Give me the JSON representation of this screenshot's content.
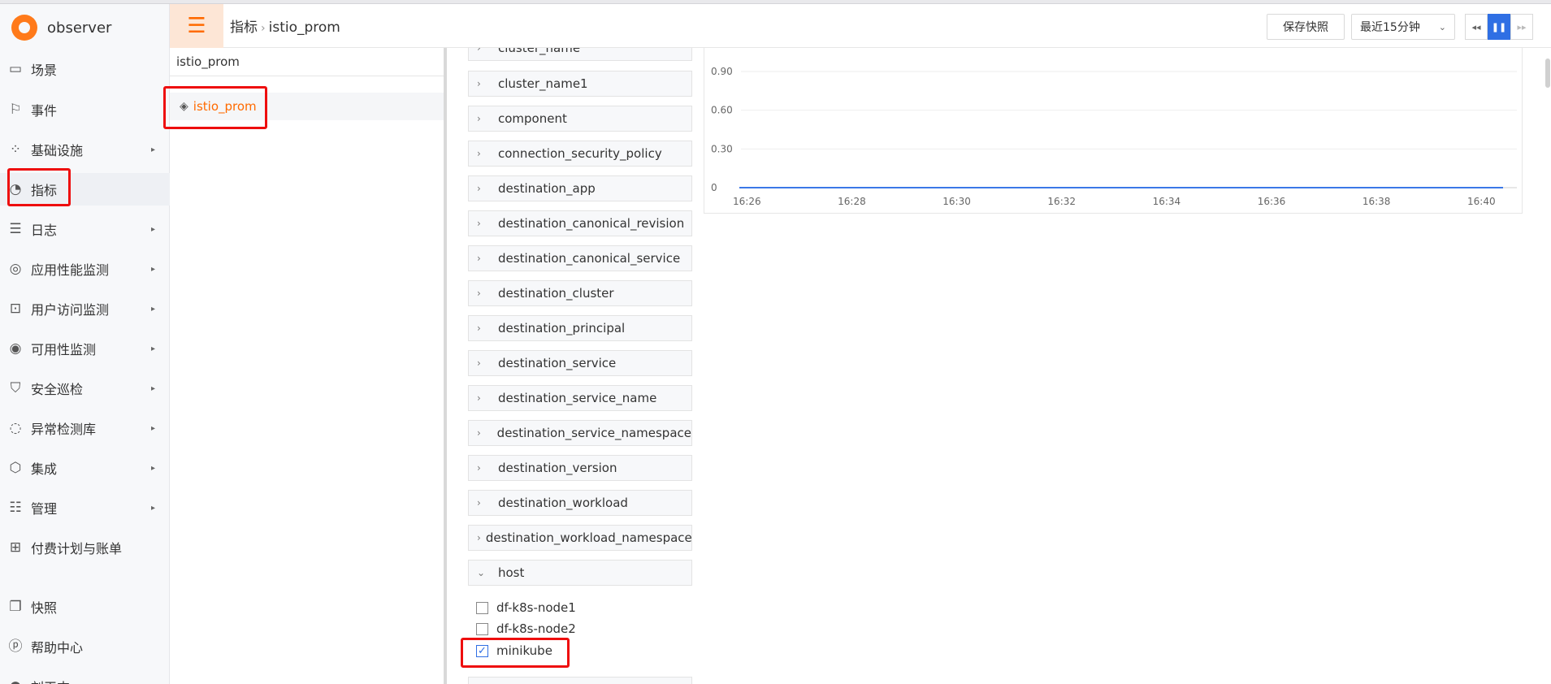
{
  "app": {
    "name": "observer"
  },
  "sidebar": {
    "items": [
      {
        "label": "场景",
        "icon": "dashboard-icon",
        "has_submenu": false
      },
      {
        "label": "事件",
        "icon": "flag-icon",
        "has_submenu": false
      },
      {
        "label": "基础设施",
        "icon": "apps-icon",
        "has_submenu": true
      },
      {
        "label": "指标",
        "icon": "metrics-icon",
        "has_submenu": false,
        "active": true
      },
      {
        "label": "日志",
        "icon": "log-icon",
        "has_submenu": true
      },
      {
        "label": "应用性能监测",
        "icon": "target-icon",
        "has_submenu": true
      },
      {
        "label": "用户访问监测",
        "icon": "monitor-icon",
        "has_submenu": true
      },
      {
        "label": "可用性监测",
        "icon": "signal-icon",
        "has_submenu": true
      },
      {
        "label": "安全巡检",
        "icon": "shield-icon",
        "has_submenu": true
      },
      {
        "label": "异常检测库",
        "icon": "radar-icon",
        "has_submenu": true
      },
      {
        "label": "集成",
        "icon": "cube-icon",
        "has_submenu": true
      },
      {
        "label": "管理",
        "icon": "sliders-icon",
        "has_submenu": true
      },
      {
        "label": "付费计划与账单",
        "icon": "billing-icon",
        "has_submenu": false
      },
      {
        "label": "快照",
        "icon": "snapshot-icon",
        "has_submenu": false
      },
      {
        "label": "帮助中心",
        "icon": "help-icon",
        "has_submenu": false
      },
      {
        "label": "刘玉杰",
        "icon": "avatar-icon",
        "has_submenu": true
      }
    ]
  },
  "header": {
    "breadcrumb": {
      "parent": "指标",
      "current": "istio_prom"
    },
    "save_snapshot": "保存快照",
    "time_range": "最近15分钟"
  },
  "tree": {
    "title": "istio_prom",
    "node": "istio_prom"
  },
  "filters": {
    "tags": [
      "cluster_name",
      "cluster_name1",
      "component",
      "connection_security_policy",
      "destination_app",
      "destination_canonical_revision",
      "destination_canonical_service",
      "destination_cluster",
      "destination_principal",
      "destination_service",
      "destination_service_name",
      "destination_service_namespace",
      "destination_version",
      "destination_workload",
      "destination_workload_namespace",
      "host"
    ],
    "host_values": [
      {
        "label": "df-k8s-node1",
        "checked": false
      },
      {
        "label": "df-k8s-node2",
        "checked": false
      },
      {
        "label": "minikube",
        "checked": true
      }
    ]
  },
  "chart_data": {
    "type": "line",
    "x": [
      "16:26",
      "16:28",
      "16:30",
      "16:32",
      "16:34",
      "16:36",
      "16:38",
      "16:40"
    ],
    "yticks": [
      "0",
      "0.30",
      "0.60",
      "0.90"
    ],
    "ylim": [
      0,
      0.9
    ],
    "series": [
      {
        "values": [
          0,
          0,
          0,
          0,
          0,
          0,
          0,
          0
        ],
        "color": "#3b78e7"
      }
    ],
    "grid": true
  },
  "colors": {
    "accent": "#ff6a00",
    "highlight": "#ee0e0e",
    "primary": "#2f6fe4"
  }
}
